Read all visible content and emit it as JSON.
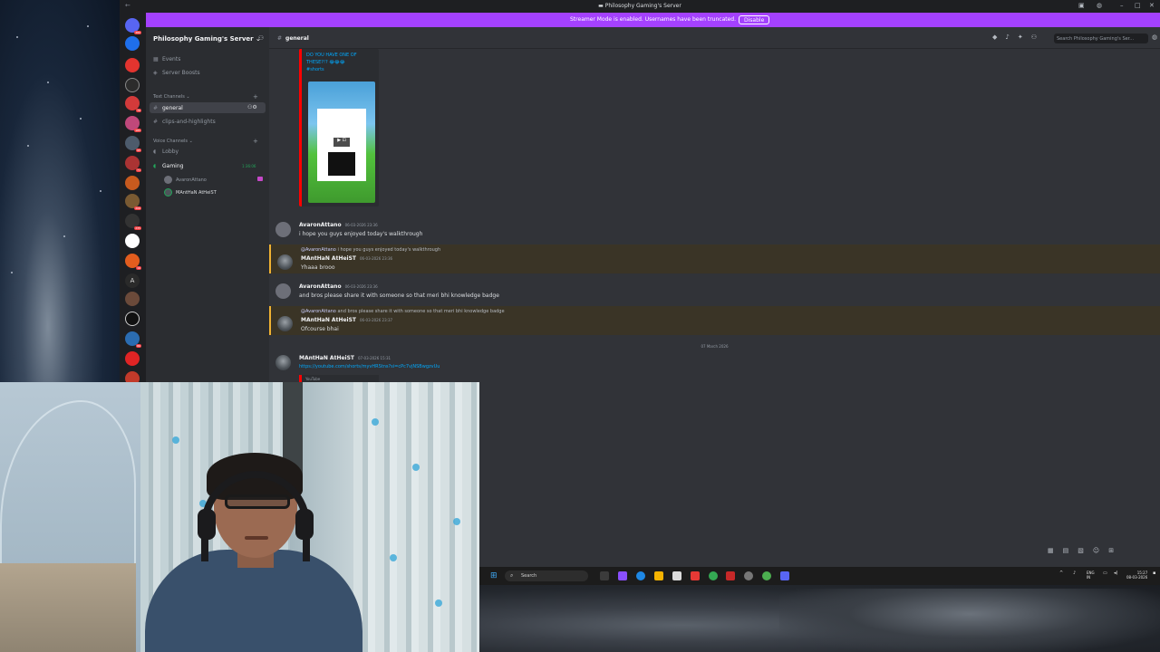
{
  "window": {
    "title": "Philosophy Gaming's Server",
    "banner_text": "Streamer Mode is enabled. Usernames have been truncated.",
    "banner_button": "Disable"
  },
  "guild_badges": [
    "380",
    "76",
    "185",
    "95",
    "71",
    "206",
    "235",
    "16",
    "86"
  ],
  "sidebar": {
    "server_name": "Philosophy Gaming's Server",
    "events": "Events",
    "boosts": "Server Boosts",
    "text_category": "Text Channels",
    "text_channels": [
      "general",
      "clips-and-highlights"
    ],
    "voice_category": "Voice Channels",
    "voice_channels": [
      "Lobby",
      "Gaming"
    ],
    "voice_timer": "1:36:06",
    "voice_users": [
      "AvaronAttano",
      "MAntHaN AtHeiST"
    ]
  },
  "chat": {
    "channel": "general",
    "search_placeholder": "Search Philosophy Gaming's Ser...",
    "embed_title": "DO YOU HAVE ONE OF THESE?!?",
    "embed_emojis": "😂😂😂",
    "embed_tag": "#shorts",
    "date_divider": "07 March 2026",
    "messages": [
      {
        "author": "AvaronAttano",
        "time": "06-03-2026 23:36",
        "text": "i hope you guys enjoyed today's walkthrough"
      },
      {
        "reply_to": "@AvaronAttano",
        "reply_text": "i hope you guys enjoyed today's walkthrough",
        "author": "MAntHaN AtHeiST",
        "time": "06-03-2026 23:36",
        "text": "Yhaaa brooo"
      },
      {
        "author": "AvaronAttano",
        "time": "06-03-2026 23:36",
        "text": "and bros please share it with someone so that meri bhi knowledge badge"
      },
      {
        "reply_to": "@AvaronAttano",
        "reply_text": "and bros please share it with someone so that meri bhi knowledge badge",
        "author": "MAntHaN AtHeiST",
        "time": "06-03-2026 23:37",
        "text": "Ofcourse bhai"
      },
      {
        "author": "MAntHaN AtHeiST",
        "time": "07-03-2026 15:31",
        "link": "https://youtube.com/shorts/myvHRStns?si=cPc7vjNSBwgzvUu",
        "embed_source": "YouTube"
      }
    ]
  },
  "taskbar": {
    "search": "Search",
    "lang": "ENG",
    "region": "IN",
    "time": "15:27",
    "date": "08-03-2026"
  }
}
